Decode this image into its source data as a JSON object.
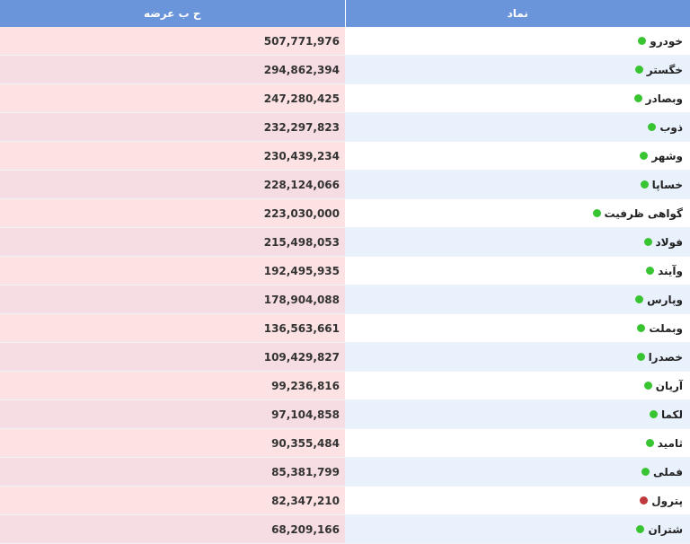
{
  "table": {
    "headers": {
      "symbol": "نماد",
      "value": "ح ب عرضه"
    },
    "rows": [
      {
        "symbol": "خودرو",
        "value": "507,771,976",
        "status": "up"
      },
      {
        "symbol": "خگستر",
        "value": "294,862,394",
        "status": "up"
      },
      {
        "symbol": "وبصادر",
        "value": "247,280,425",
        "status": "up"
      },
      {
        "symbol": "ذوب",
        "value": "232,297,823",
        "status": "up"
      },
      {
        "symbol": "وشهر",
        "value": "230,439,234",
        "status": "up"
      },
      {
        "symbol": "خساپا",
        "value": "228,124,066",
        "status": "up"
      },
      {
        "symbol": "گواهی ظرفیت",
        "value": "223,030,000",
        "status": "up"
      },
      {
        "symbol": "فولاد",
        "value": "215,498,053",
        "status": "up"
      },
      {
        "symbol": "وآیند",
        "value": "192,495,935",
        "status": "up"
      },
      {
        "symbol": "وپارس",
        "value": "178,904,088",
        "status": "up"
      },
      {
        "symbol": "وبملت",
        "value": "136,563,661",
        "status": "up"
      },
      {
        "symbol": "خصدرا",
        "value": "109,429,827",
        "status": "up"
      },
      {
        "symbol": "آریان",
        "value": "99,236,816",
        "status": "up"
      },
      {
        "symbol": "لکما",
        "value": "97,104,858",
        "status": "up"
      },
      {
        "symbol": "ثامید",
        "value": "90,355,484",
        "status": "up"
      },
      {
        "symbol": "فملی",
        "value": "85,381,799",
        "status": "up"
      },
      {
        "symbol": "پترول",
        "value": "82,347,210",
        "status": "down"
      },
      {
        "symbol": "شتران",
        "value": "68,209,166",
        "status": "up"
      }
    ]
  },
  "colors": {
    "header_bg": "#6b95da",
    "status_up": "#39c432",
    "status_down": "#c0393c"
  },
  "icons": {
    "status": "status-dot-icon"
  }
}
